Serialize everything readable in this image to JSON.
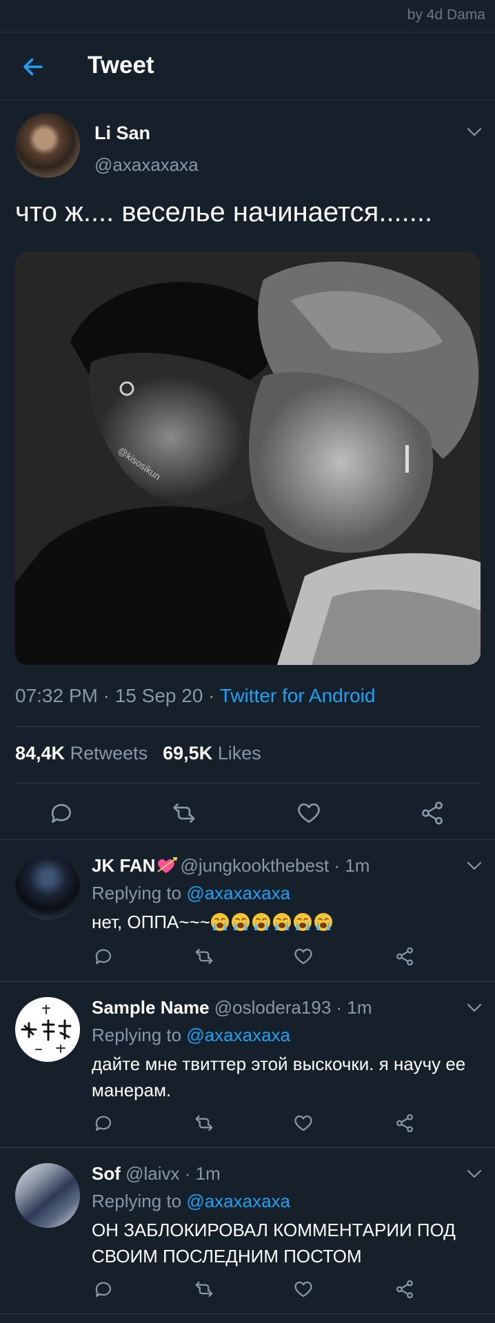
{
  "watermark": "by 4d Dama",
  "header": {
    "title": "Tweet"
  },
  "main_tweet": {
    "author_name": "Li San",
    "author_handle": "@axaxaxaxa",
    "text": "что ж.... веселье начинается.......",
    "image_watermark": "@kisosikun",
    "time": "07:32 PM · 15 Sep 20 · ",
    "source": "Twitter for Android",
    "retweets_count": "84,4K",
    "retweets_label": "Retweets",
    "likes_count": "69,5K",
    "likes_label": "Likes"
  },
  "replies": [
    {
      "name": "JK FAN",
      "handle": "@jungkookthebest · 1m",
      "replying_prefix": "Replying to ",
      "replying_to": "@axaxaxaxa",
      "text": "нет, ОППА~~~",
      "emoji_count": 6
    },
    {
      "name": "Sample Name",
      "handle": "@oslodera193 · 1m",
      "replying_prefix": "Replying to ",
      "replying_to": "@axaxaxaxa",
      "text": "дайте мне твиттер этой выскочки. я научу ее манерам."
    },
    {
      "name": "Sof",
      "handle": "@laivx · 1m",
      "replying_prefix": "Replying to ",
      "replying_to": "@axaxaxaxa",
      "text": "ОН ЗАБЛОКИРОВАЛ КОММЕНТАРИИ ПОД СВОИМ ПОСЛЕДНИМ ПОСТОМ"
    }
  ],
  "icons": {
    "back": "arrow-left-icon",
    "reply": "speech-bubble-icon",
    "retweet": "retweet-icon",
    "like": "heart-icon",
    "share": "share-icon",
    "more": "chevron-down-icon"
  },
  "colors": {
    "background": "#15202b",
    "accent": "#1da1f2",
    "secondary_text": "#8899a6",
    "divider": "#2f3b47"
  }
}
